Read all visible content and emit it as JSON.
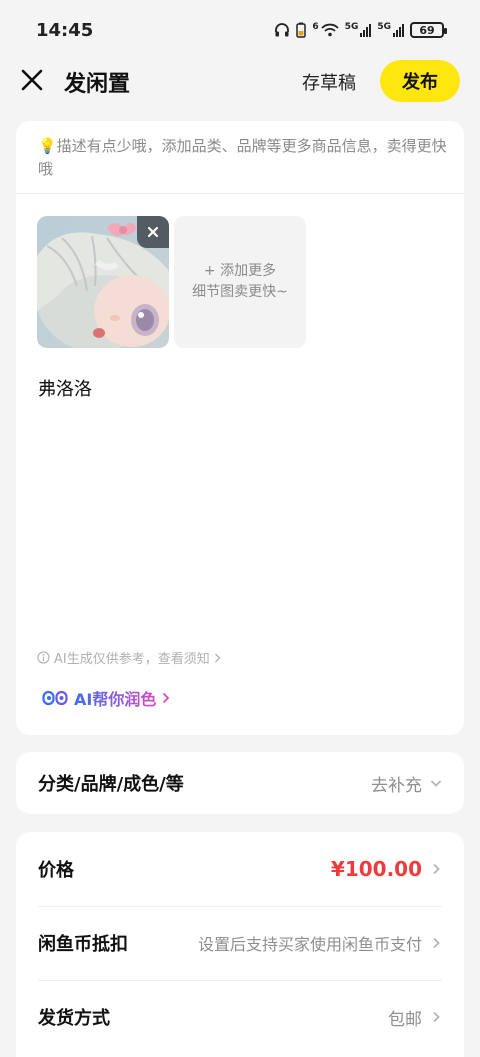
{
  "status_bar": {
    "time": "14:45",
    "network_a": "6",
    "network_b": "5G",
    "network_c": "5G",
    "battery": "69"
  },
  "nav": {
    "title": "发闲置",
    "draft_label": "存草稿",
    "publish_label": "发布",
    "accent_color": "#ffe60f"
  },
  "description": {
    "tip": "💡描述有点少哦，添加品类、品牌等更多商品信息，卖得更快哦",
    "add_more_line1": "+ 添加更多",
    "add_more_line2": "细节图卖更快~",
    "text": "弗洛洛",
    "ai_note": "AI生成仅供参考，查看须知",
    "ai_polish": "AI帮你润色"
  },
  "category": {
    "label": "分类/品牌/成色/等",
    "value": "去补充"
  },
  "details": {
    "price_label": "价格",
    "price_value": "¥100.00",
    "price_color": "#ef3b3b",
    "coin_label": "闲鱼币抵扣",
    "coin_value": "设置后支持买家使用闲鱼币支付",
    "shipping_label": "发货方式",
    "shipping_value": "包邮"
  }
}
